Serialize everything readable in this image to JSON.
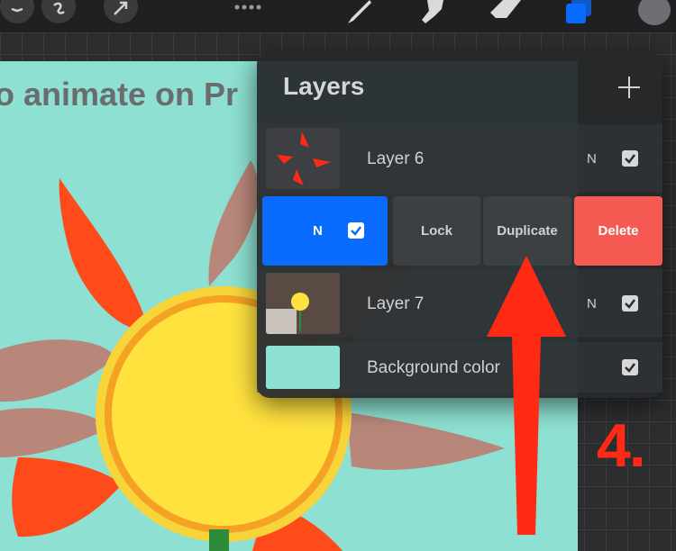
{
  "canvas": {
    "title_text": "o animate on Pr"
  },
  "layers_panel": {
    "title": "Layers",
    "add_icon": "plus-icon",
    "layers": [
      {
        "name": "Layer 6",
        "blend_mode": "N",
        "visible": true
      },
      {
        "name": "",
        "blend_mode": "N",
        "visible": true,
        "selected": true
      },
      {
        "name": "Layer 7",
        "blend_mode": "N",
        "visible": true
      },
      {
        "name": "Background color",
        "visible": true
      }
    ],
    "actions": {
      "lock": "Lock",
      "duplicate": "Duplicate",
      "delete": "Delete"
    }
  },
  "toolbar": {
    "icons": [
      "adjustments-icon",
      "selection-icon",
      "transform-icon",
      "more-icon",
      "brush-icon",
      "smudge-icon",
      "eraser-icon",
      "layers-icon",
      "color-icon"
    ]
  },
  "annotation": {
    "step_label": "4."
  },
  "colors": {
    "accent_blue": "#0a6cff",
    "delete_red": "#f55a52",
    "annotation_red": "#ff2a14",
    "canvas_bg": "#8de0d2",
    "background_color_swatch": "#8de0d2"
  }
}
